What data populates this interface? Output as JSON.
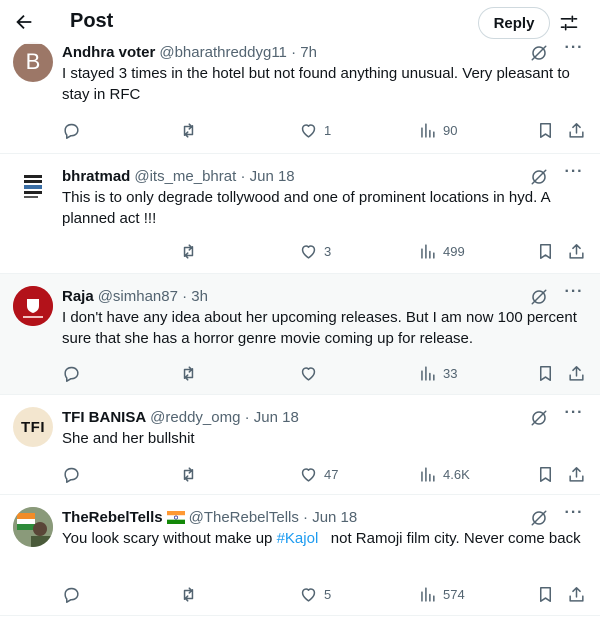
{
  "header": {
    "title": "Post",
    "reply_label": "Reply"
  },
  "icons": {
    "back": "arrow-left-icon",
    "filter": "sliders-icon",
    "reply": "speech-bubble-icon",
    "repost": "repost-arrows-icon",
    "like": "heart-icon",
    "views": "bar-chart-icon",
    "bookmark": "bookmark-icon",
    "share": "share-upload-icon",
    "grok": "grok-slash-icon",
    "more": "ellipsis-icon"
  },
  "colors": {
    "text": "#0f1419",
    "secondary": "#536471",
    "link": "#1d9bf0",
    "divider": "#eff3f4",
    "highlight_bg": "#f7f9f9"
  },
  "posts": [
    {
      "name": "Andhra voter",
      "handle": "@bharathreddyg11 · 7h",
      "text": "I stayed 3 times in the hotel but not found anything unusual. Very pleasant to stay in RFC",
      "avatar_letter": "B",
      "likes": "1",
      "views": "90"
    },
    {
      "name": "bhratmad",
      "handle": "@its_me_bhrat · Jun 18",
      "text": "This is to only degrade tollywood and one of prominent locations in hyd. A planned act !!!",
      "likes": "3",
      "views": "499"
    },
    {
      "name": "Raja",
      "handle": "@simhan87 · 3h",
      "text": "I don't have any idea about her upcoming releases. But I am now 100 percent sure that she has a horror genre movie coming up for release.",
      "likes": "",
      "views": "33"
    },
    {
      "name": "TFI BANISA",
      "handle": "@reddy_omg · Jun 18",
      "text": "She and her bullshit",
      "avatar_text": "TFI",
      "likes": "47",
      "views": "4.6K"
    },
    {
      "name": "TheRebelTells",
      "handle": "@TheRebelTells · Jun 18",
      "text_before": "You look scary without make up ",
      "hashtag": "#Kajol",
      "text_after": "   not Ramoji film city. Never come back",
      "likes": "5",
      "views": "574"
    }
  ]
}
